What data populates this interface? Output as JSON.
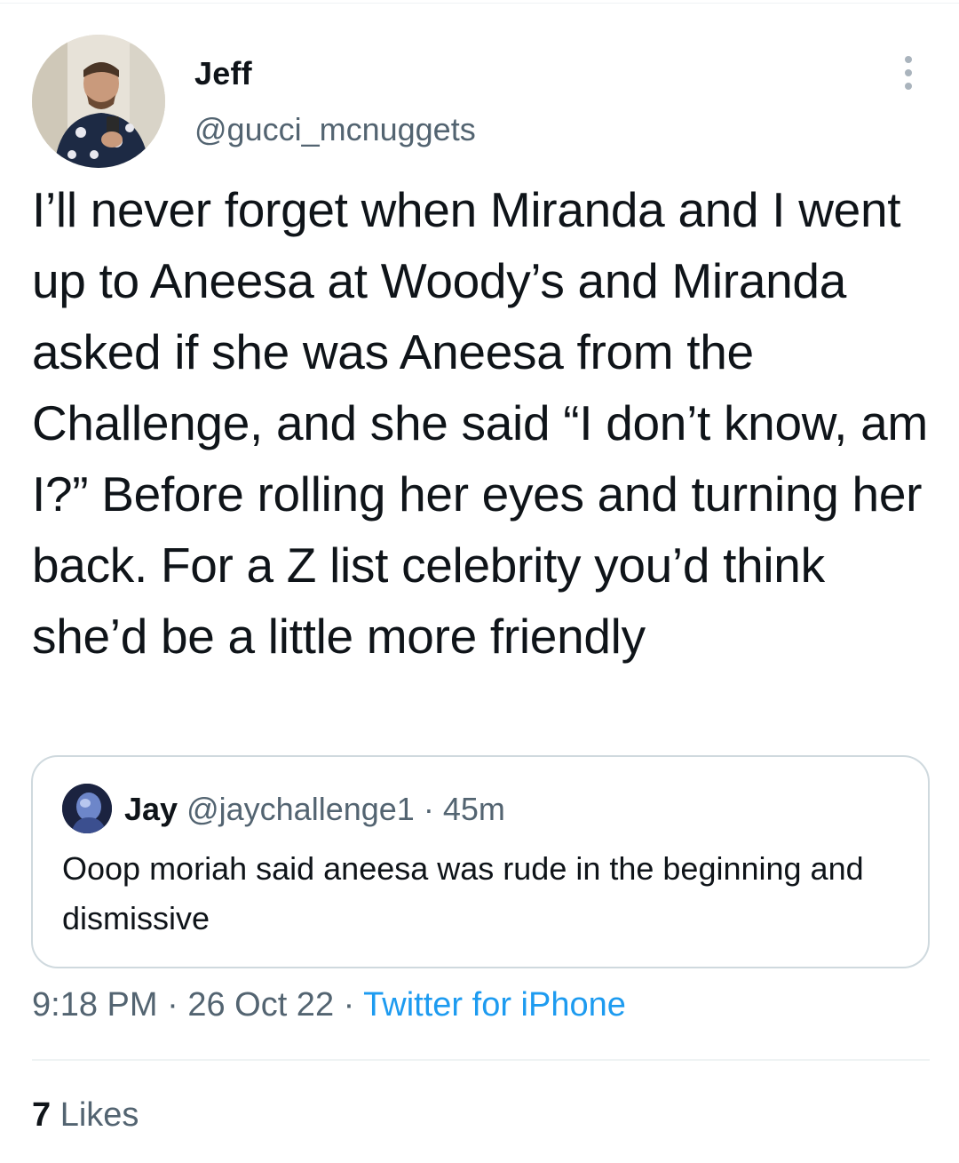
{
  "author": {
    "name": "Jeff",
    "handle": "@gucci_mcnuggets"
  },
  "tweet": {
    "text": "I’ll never forget when Miranda and I went up to Aneesa at Woody’s and Miranda asked if she was Aneesa from the Challenge, and she said “I don’t know, am I?” Before rolling her eyes and turning her back. For a Z list celebrity you’d think she’d be a little more friendly"
  },
  "quoted": {
    "name": "Jay",
    "handle": "@jaychallenge1",
    "separator": "·",
    "time": "45m",
    "text": "Ooop moriah said aneesa was rude in the beginning and dismissive"
  },
  "meta": {
    "time": "9:18 PM",
    "dot1": "·",
    "date": "26 Oct 22",
    "dot2": "·",
    "source": "Twitter for iPhone"
  },
  "stats": {
    "likes_count": "7",
    "likes_label": "Likes"
  },
  "icons": {
    "more": "more-options-icon"
  },
  "colors": {
    "link": "#1d9bf0",
    "secondary_text": "#536471",
    "primary_text": "#0f1419",
    "border": "#cfd9de"
  }
}
